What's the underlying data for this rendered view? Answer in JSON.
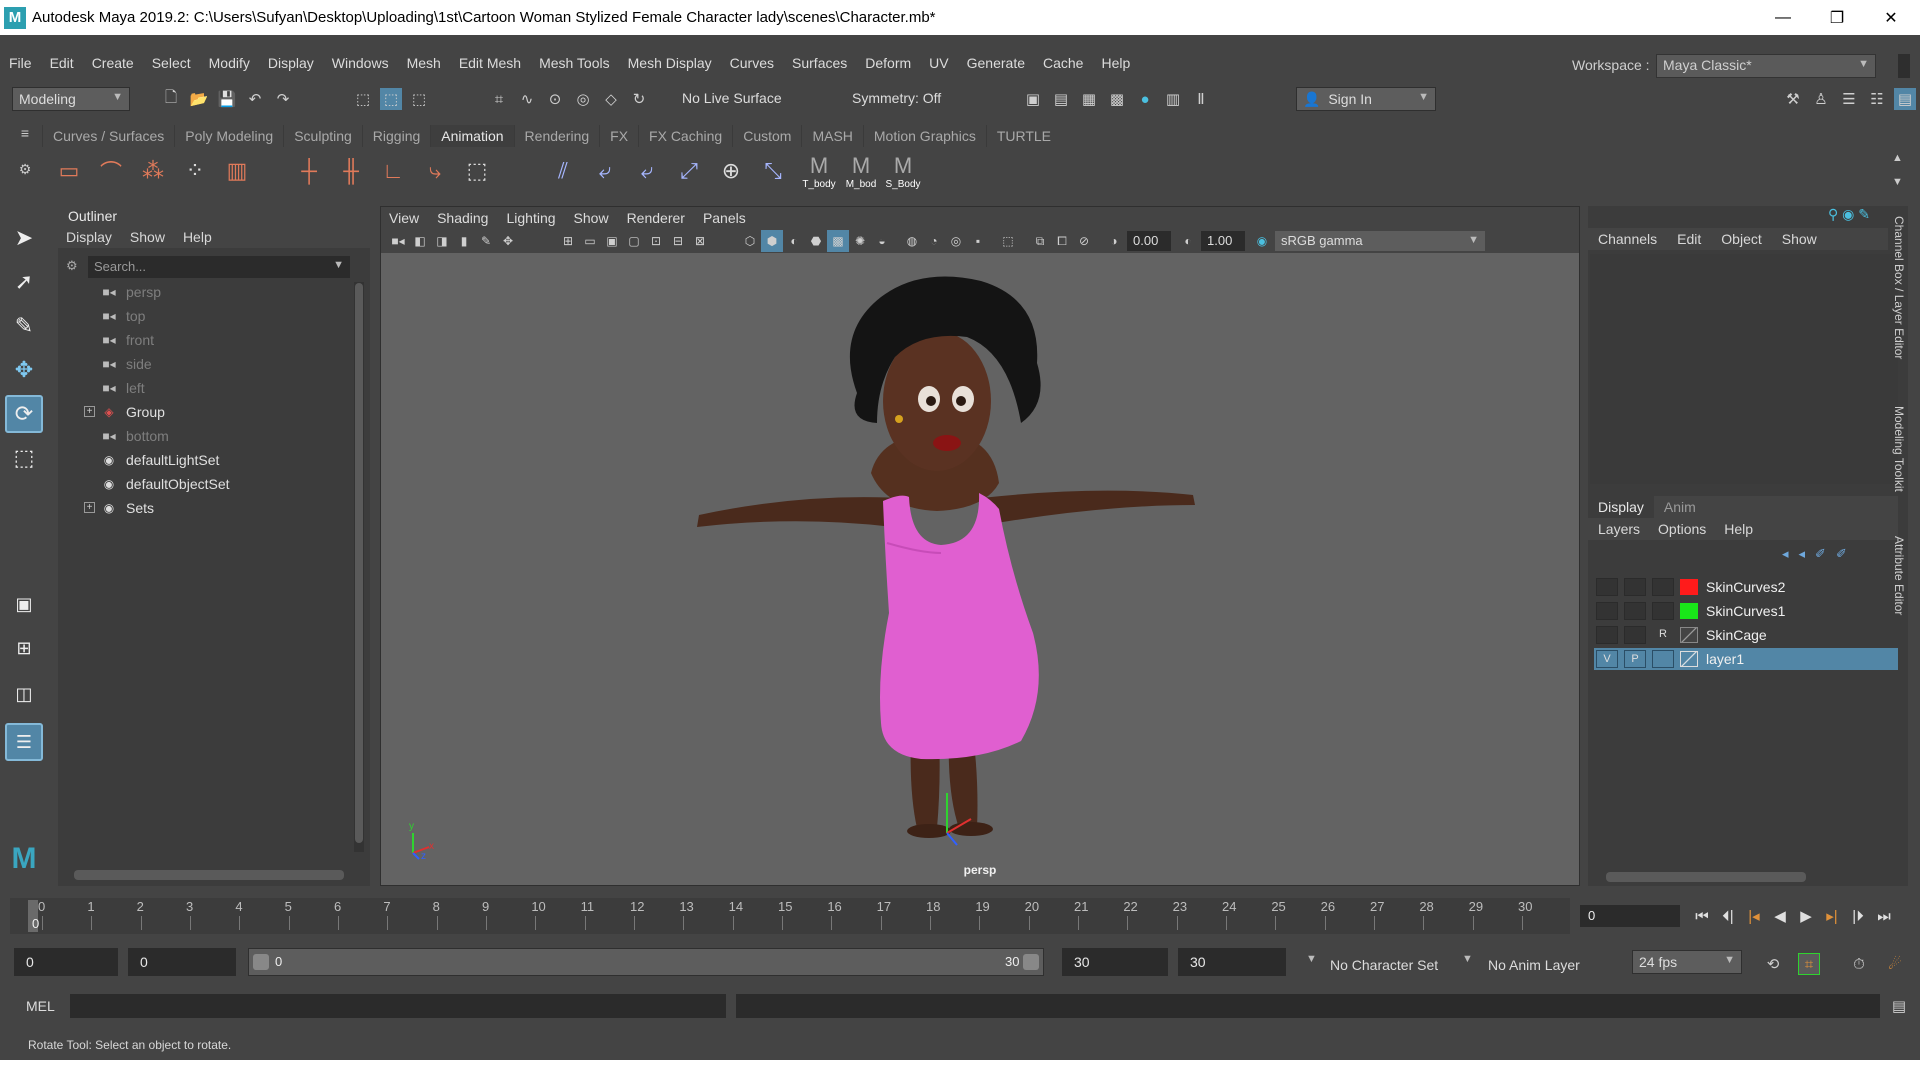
{
  "window": {
    "title": "Autodesk Maya 2019.2: C:\\Users\\Sufyan\\Desktop\\Uploading\\1st\\Cartoon Woman Stylized Female Character lady\\scenes\\Character.mb*",
    "logo": "M",
    "minimize": "—",
    "restore": "❐",
    "close": "✕"
  },
  "menubar": {
    "items": [
      "File",
      "Edit",
      "Create",
      "Select",
      "Modify",
      "Display",
      "Windows",
      "Mesh",
      "Edit Mesh",
      "Mesh Tools",
      "Mesh Display",
      "Curves",
      "Surfaces",
      "Deform",
      "UV",
      "Generate",
      "Cache",
      "Help"
    ],
    "workspace_label": "Workspace :",
    "workspace_value": "Maya Classic*"
  },
  "statusline": {
    "mode": "Modeling",
    "live_surface": "No Live Surface",
    "symmetry": "Symmetry: Off",
    "sign_in": "Sign In"
  },
  "shelf": {
    "tabs": [
      "Curves / Surfaces",
      "Poly Modeling",
      "Sculpting",
      "Rigging",
      "Animation",
      "Rendering",
      "FX",
      "FX Caching",
      "Custom",
      "MASH",
      "Motion Graphics",
      "TURTLE"
    ],
    "active_tab": "Animation",
    "labels": [
      "T_body",
      "M_bod",
      "S_Body"
    ]
  },
  "outliner": {
    "title": "Outliner",
    "menu": [
      "Display",
      "Show",
      "Help"
    ],
    "search_placeholder": "Search...",
    "items": [
      {
        "label": "persp",
        "icon": "camera-icon",
        "dim": true
      },
      {
        "label": "top",
        "icon": "camera-icon",
        "dim": true
      },
      {
        "label": "front",
        "icon": "camera-icon",
        "dim": true
      },
      {
        "label": "side",
        "icon": "camera-icon",
        "dim": true
      },
      {
        "label": "left",
        "icon": "camera-icon",
        "dim": true
      },
      {
        "label": "Group",
        "icon": "group-icon",
        "dim": false,
        "expander": "+"
      },
      {
        "label": "bottom",
        "icon": "camera-icon",
        "dim": true
      },
      {
        "label": "defaultLightSet",
        "icon": "set-icon",
        "dim": false
      },
      {
        "label": "defaultObjectSet",
        "icon": "set-icon",
        "dim": false
      },
      {
        "label": "Sets",
        "icon": "set-icon",
        "dim": false,
        "expander": "+"
      }
    ]
  },
  "viewport": {
    "menu": [
      "View",
      "Shading",
      "Lighting",
      "Show",
      "Renderer",
      "Panels"
    ],
    "exposure": "0.00",
    "gamma": "1.00",
    "color_space": "sRGB gamma",
    "camera_label": "persp",
    "axis_x": "x",
    "axis_y": "y",
    "axis_z": "z"
  },
  "channelbox": {
    "menu": [
      "Channels",
      "Edit",
      "Object",
      "Show"
    ],
    "layer_tabs": [
      "Display",
      "Anim"
    ],
    "layer_menu": [
      "Layers",
      "Options",
      "Help"
    ],
    "layers": [
      {
        "name": "SkinCurves2",
        "v": "",
        "p": "",
        "r": "",
        "color": "#ff1b1b",
        "selected": false
      },
      {
        "name": "SkinCurves1",
        "v": "",
        "p": "",
        "r": "",
        "color": "#19e619",
        "selected": false
      },
      {
        "name": "SkinCage",
        "v": "",
        "p": "",
        "r": "R",
        "color": "",
        "selected": false
      },
      {
        "name": "layer1",
        "v": "V",
        "p": "P",
        "r": "",
        "color": "",
        "selected": true
      }
    ],
    "side_tabs": [
      "Channel Box / Layer Editor",
      "Modeling Toolkit",
      "Attribute Editor"
    ]
  },
  "timeline": {
    "ticks": [
      "0",
      "1",
      "2",
      "3",
      "4",
      "5",
      "6",
      "7",
      "8",
      "9",
      "10",
      "11",
      "12",
      "13",
      "14",
      "15",
      "16",
      "17",
      "18",
      "19",
      "20",
      "21",
      "22",
      "23",
      "24",
      "25",
      "26",
      "27",
      "28",
      "29",
      "30"
    ],
    "current_frame_label": "0",
    "current_frame_field": "0"
  },
  "range": {
    "start": "0",
    "playback_start": "0",
    "slider_start": "0",
    "slider_end": "30",
    "playback_end": "30",
    "end": "30",
    "character_set": "No Character Set",
    "anim_layer": "No Anim Layer",
    "fps": "24 fps"
  },
  "command": {
    "label": "MEL"
  },
  "help": {
    "text": "Rotate Tool: Select an object to rotate."
  },
  "colors": {
    "accent": "#5286a6",
    "dress": "#e05fd0",
    "skin": "#5a3222"
  }
}
